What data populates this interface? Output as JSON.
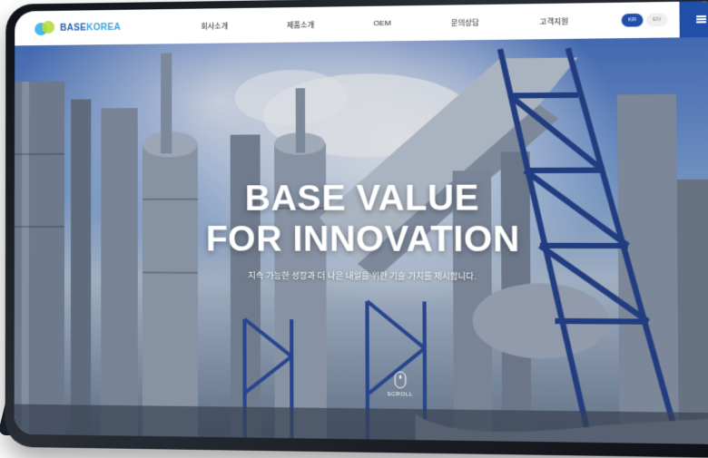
{
  "header": {
    "logo_text_base": "BASE",
    "logo_text_korea": "KOREA",
    "nav": [
      "회사소개",
      "제품소개",
      "OEM",
      "문의상담",
      "고객지원"
    ],
    "lang": {
      "active": "KR",
      "other": "EN"
    },
    "menu_icon": "hamburger-icon",
    "accent_color": "#1f4fa8"
  },
  "hero": {
    "title_line1": "BASE VALUE",
    "title_line2": "FOR INNOVATION",
    "subtitle": "지속 가능한 성장과 더 나은 내일을 위한 기술 가치를 제시합니다.",
    "scroll_label": "SCROLL",
    "scroll_icon": "mouse-icon"
  }
}
